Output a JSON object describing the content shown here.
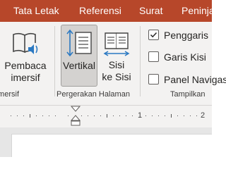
{
  "tabs": [
    "Tata Letak",
    "Referensi",
    "Surat",
    "Peninjauan"
  ],
  "groups": {
    "imersif": {
      "label": "Imersif",
      "read_aloud_label_line1": "Pembaca",
      "read_aloud_label_line2": "imersif"
    },
    "page_movement": {
      "label": "Pergerakan Halaman",
      "vertical_label": "Vertikal",
      "side_label_line1": "Sisi",
      "side_label_line2": "ke Sisi"
    },
    "show": {
      "label": "Tampilkan",
      "checkboxes": [
        {
          "label": "Penggaris",
          "checked": true
        },
        {
          "label": "Garis Kisi",
          "checked": false
        },
        {
          "label": "Panel Navigasi",
          "checked": false
        }
      ]
    }
  },
  "ruler": {
    "marks": [
      "1",
      "2"
    ]
  },
  "colors": {
    "accent": "#b7472a",
    "ribbon_bg": "#f3f2f1",
    "icon_blue": "#2b79c2"
  }
}
